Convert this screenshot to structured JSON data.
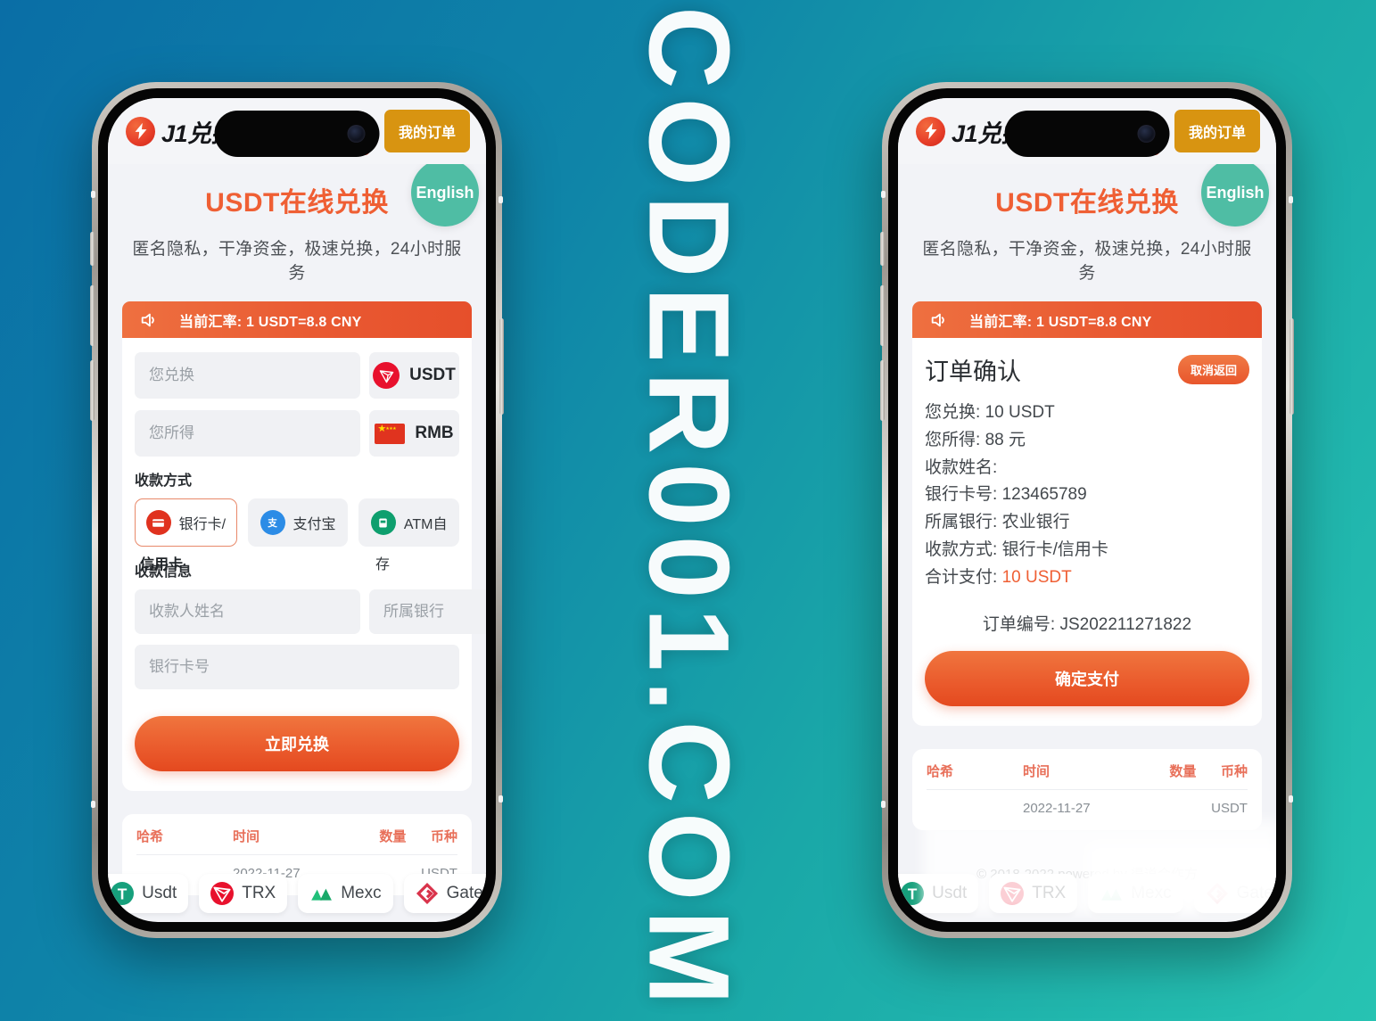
{
  "watermark": {
    "text": "CODER001.COM"
  },
  "header": {
    "logo_text": "J1兑换",
    "logo_icon": "lightning-logo-icon",
    "my_orders_label": "我的订单"
  },
  "hero": {
    "title": "USDT在线兑换",
    "lang_badge": "English",
    "subtitle": "匿名隐私，干净资金，极速兑换，24小时服务"
  },
  "rate_banner": {
    "icon": "megaphone-icon",
    "text": "当前汇率: 1 USDT=8.8 CNY"
  },
  "exchange_form": {
    "pay_placeholder": "您兑换",
    "pay_coin": "USDT",
    "receive_placeholder": "您所得",
    "receive_coin": "RMB",
    "method_label": "收款方式",
    "methods": [
      {
        "label": "银行卡/信用卡",
        "visible": "银行卡/",
        "overflow": "信用卡",
        "icon": "bank-card-icon",
        "selected": true
      },
      {
        "label": "支付宝",
        "visible": "支付宝",
        "overflow": "",
        "icon": "alipay-icon",
        "selected": false
      },
      {
        "label": "ATM自存",
        "visible": "ATM自",
        "overflow": "存",
        "icon": "atm-icon",
        "selected": false
      }
    ],
    "info_label": "收款信息",
    "name_placeholder": "收款人姓名",
    "bank_placeholder": "所属银行",
    "card_placeholder": "银行卡号",
    "submit_label": "立即兑换"
  },
  "order_confirm": {
    "title": "订单确认",
    "cancel_label": "取消返回",
    "lines": [
      {
        "label": "您兑换:",
        "value": "10 USDT",
        "accent": false
      },
      {
        "label": "您所得:",
        "value": "88 元",
        "accent": false
      },
      {
        "label": "收款姓名:",
        "value": "",
        "accent": false
      },
      {
        "label": "银行卡号:",
        "value": "123465789",
        "accent": false
      },
      {
        "label": "所属银行:",
        "value": "农业银行",
        "accent": false
      },
      {
        "label": "收款方式:",
        "value": "银行卡/信用卡",
        "accent": false
      },
      {
        "label": "合计支付:",
        "value": "10 USDT",
        "accent": true
      }
    ],
    "order_no_label": "订单编号:",
    "order_no": "JS202211271822",
    "confirm_label": "确定支付"
  },
  "tx_table": {
    "headers": [
      "哈希",
      "时间",
      "数量",
      "币种"
    ],
    "rows": [
      {
        "hash": "",
        "time": "2022-11-27",
        "amount": "",
        "coin": "USDT"
      }
    ]
  },
  "footer": {
    "copyright": "© 2018-2022 powered by 渠道合作方",
    "chips": [
      {
        "label": "Usdt",
        "icon": "tether-icon"
      },
      {
        "label": "TRX",
        "icon": "tron-icon"
      },
      {
        "label": "Mexc",
        "icon": "mexc-icon"
      },
      {
        "label": "Gate",
        "icon": "gate-icon"
      }
    ]
  },
  "colors": {
    "accent_orange": "#ef5f34",
    "banner_orange": "#e95a32",
    "badge_teal": "#4fbda4",
    "orders_gold": "#d89411",
    "table_header": "#e8705a",
    "bg_blue": "#0a6ea6",
    "bg_teal": "#27c3b2"
  }
}
